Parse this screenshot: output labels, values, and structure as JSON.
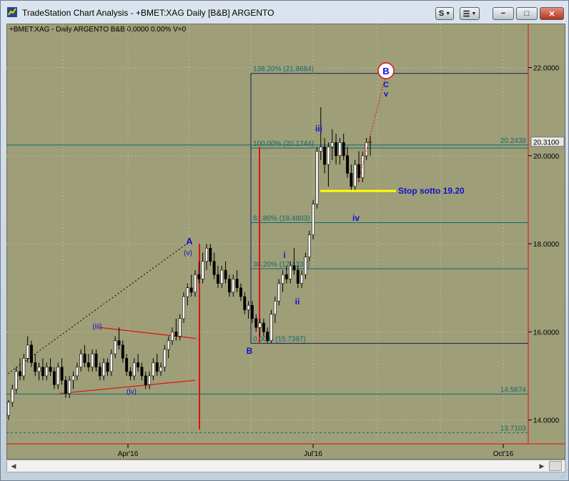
{
  "window": {
    "title": "TradeStation Chart Analysis - +BMET:XAG Daily [B&B] ARGENTO",
    "btn_s": "S",
    "btn_list": "☰",
    "btn_min": "−",
    "btn_max": "□",
    "btn_close": "✕"
  },
  "header": {
    "symbol_info": "+BMET:XAG - Daily  ARGENTO  B&B  0.0000  0.00%  V=0"
  },
  "colors": {
    "background": "#9e9e78",
    "grid": "#b8b894",
    "up_candle": "#ffffff",
    "down_candle": "#000000",
    "fib_line": "#0e6b6b",
    "fib_text": "#0e6b6b",
    "wave_label": "#1010cc",
    "red_line": "#e01010",
    "stop_line": "#ffff00"
  },
  "chart_data": {
    "type": "candlestick",
    "ylim": [
      13.1,
      23.0
    ],
    "yticks": [
      "22.0000",
      "20.0000",
      "18.0000",
      "16.0000",
      "14.0000"
    ],
    "xticks": [
      "Apr'16",
      "Jul'16",
      "Oct'16"
    ],
    "last_price": "20.3100",
    "candles": [
      [
        14.1,
        14.45,
        14.0,
        14.4
      ],
      [
        14.4,
        14.8,
        14.3,
        14.7
      ],
      [
        14.7,
        15.2,
        14.6,
        15.1
      ],
      [
        15.1,
        15.4,
        14.9,
        15.0
      ],
      [
        15.0,
        15.5,
        14.9,
        15.4
      ],
      [
        15.4,
        15.9,
        15.3,
        15.7
      ],
      [
        15.7,
        15.8,
        15.2,
        15.3
      ],
      [
        15.3,
        15.5,
        15.0,
        15.1
      ],
      [
        15.1,
        15.3,
        14.9,
        15.2
      ],
      [
        15.2,
        15.4,
        14.9,
        15.0
      ],
      [
        15.0,
        15.3,
        14.9,
        15.2
      ],
      [
        15.2,
        15.4,
        15.0,
        15.1
      ],
      [
        15.1,
        15.2,
        14.7,
        14.8
      ],
      [
        14.8,
        15.3,
        14.7,
        15.2
      ],
      [
        15.2,
        15.4,
        14.8,
        14.9
      ],
      [
        14.9,
        15.0,
        14.5,
        14.6
      ],
      [
        14.6,
        15.0,
        14.5,
        14.9
      ],
      [
        14.9,
        15.1,
        14.7,
        15.0
      ],
      [
        15.0,
        15.3,
        14.9,
        15.2
      ],
      [
        15.2,
        15.6,
        15.1,
        15.5
      ],
      [
        15.5,
        15.7,
        15.2,
        15.3
      ],
      [
        15.3,
        15.5,
        15.1,
        15.2
      ],
      [
        15.2,
        15.6,
        15.1,
        15.5
      ],
      [
        15.5,
        15.6,
        15.1,
        15.2
      ],
      [
        15.2,
        15.3,
        14.9,
        15.0
      ],
      [
        15.0,
        15.4,
        14.9,
        15.3
      ],
      [
        15.3,
        15.4,
        15.0,
        15.1
      ],
      [
        15.1,
        15.6,
        15.0,
        15.5
      ],
      [
        15.5,
        15.9,
        15.4,
        15.8
      ],
      [
        15.8,
        16.1,
        15.6,
        15.7
      ],
      [
        15.7,
        15.8,
        15.3,
        15.4
      ],
      [
        15.4,
        15.5,
        15.0,
        15.1
      ],
      [
        15.1,
        15.2,
        14.9,
        15.0
      ],
      [
        15.0,
        15.4,
        14.9,
        15.3
      ],
      [
        15.3,
        15.5,
        15.1,
        15.2
      ],
      [
        15.2,
        15.3,
        14.9,
        15.0
      ],
      [
        15.0,
        15.1,
        14.7,
        14.8
      ],
      [
        14.8,
        15.1,
        14.7,
        15.0
      ],
      [
        15.0,
        15.4,
        14.9,
        15.3
      ],
      [
        15.3,
        15.5,
        15.0,
        15.1
      ],
      [
        15.1,
        15.3,
        15.0,
        15.2
      ],
      [
        15.2,
        15.7,
        15.1,
        15.6
      ],
      [
        15.6,
        15.9,
        15.4,
        15.8
      ],
      [
        15.8,
        16.1,
        15.7,
        16.0
      ],
      [
        16.0,
        16.3,
        15.8,
        15.9
      ],
      [
        15.9,
        16.4,
        15.8,
        16.3
      ],
      [
        16.3,
        16.9,
        16.2,
        16.8
      ],
      [
        16.8,
        17.1,
        16.6,
        17.0
      ],
      [
        17.0,
        17.3,
        16.8,
        16.9
      ],
      [
        16.9,
        17.4,
        16.8,
        17.3
      ],
      [
        17.3,
        17.6,
        17.1,
        17.2
      ],
      [
        17.2,
        17.8,
        17.1,
        17.6
      ],
      [
        17.6,
        18.0,
        17.4,
        17.9
      ],
      [
        17.9,
        18.0,
        17.5,
        17.6
      ],
      [
        17.6,
        17.8,
        17.2,
        17.3
      ],
      [
        17.3,
        17.5,
        17.0,
        17.1
      ],
      [
        17.1,
        17.5,
        17.0,
        17.4
      ],
      [
        17.4,
        17.6,
        17.1,
        17.2
      ],
      [
        17.2,
        17.3,
        16.8,
        16.9
      ],
      [
        16.9,
        17.3,
        16.8,
        17.2
      ],
      [
        17.2,
        17.4,
        16.9,
        17.0
      ],
      [
        17.0,
        17.1,
        16.7,
        16.8
      ],
      [
        16.8,
        16.9,
        16.4,
        16.5
      ],
      [
        16.5,
        16.7,
        16.3,
        16.6
      ],
      [
        16.6,
        16.7,
        16.2,
        16.3
      ],
      [
        16.3,
        16.4,
        16.0,
        16.1
      ],
      [
        16.1,
        16.3,
        15.9,
        16.2
      ],
      [
        16.2,
        16.3,
        15.9,
        16.0
      ],
      [
        16.0,
        16.1,
        15.75,
        15.8
      ],
      [
        15.8,
        16.5,
        15.75,
        16.4
      ],
      [
        16.4,
        16.8,
        16.2,
        16.7
      ],
      [
        16.7,
        17.2,
        16.6,
        17.1
      ],
      [
        17.1,
        17.4,
        16.9,
        17.3
      ],
      [
        17.3,
        17.5,
        17.1,
        17.2
      ],
      [
        17.2,
        17.6,
        17.1,
        17.5
      ],
      [
        17.5,
        17.9,
        17.3,
        17.4
      ],
      [
        17.4,
        17.5,
        17.0,
        17.1
      ],
      [
        17.1,
        17.4,
        17.0,
        17.3
      ],
      [
        17.3,
        17.8,
        17.2,
        17.7
      ],
      [
        17.7,
        18.3,
        17.6,
        18.2
      ],
      [
        18.2,
        19.0,
        18.1,
        18.9
      ],
      [
        18.9,
        20.2,
        18.8,
        20.1
      ],
      [
        20.1,
        21.1,
        19.9,
        20.2
      ],
      [
        20.2,
        20.4,
        19.6,
        19.8
      ],
      [
        19.8,
        20.3,
        19.3,
        20.2
      ],
      [
        20.2,
        20.6,
        19.9,
        20.3
      ],
      [
        20.3,
        20.5,
        19.8,
        20.0
      ],
      [
        20.0,
        20.4,
        19.8,
        20.3
      ],
      [
        20.3,
        20.5,
        19.9,
        20.0
      ],
      [
        20.0,
        20.2,
        19.5,
        19.6
      ],
      [
        19.6,
        19.8,
        19.2,
        19.3
      ],
      [
        19.3,
        19.9,
        19.2,
        19.8
      ],
      [
        19.8,
        20.1,
        19.4,
        19.5
      ],
      [
        19.5,
        20.1,
        19.4,
        20.0
      ],
      [
        20.0,
        20.4,
        19.9,
        20.3
      ],
      [
        20.3,
        20.45,
        20.0,
        20.31
      ]
    ],
    "fibonacci": [
      {
        "label": "138.20% (21.8684)",
        "value": 21.8684
      },
      {
        "label": "100.00% (20.1744)",
        "value": 20.1744
      },
      {
        "label": "61.80% (18.4803)",
        "value": 18.4803
      },
      {
        "label": "38.20% (17.4337)",
        "value": 17.4337
      },
      {
        "label": "0.00% (15.7397)",
        "value": 15.7397
      }
    ],
    "levels": [
      {
        "label": "20.2439",
        "value": 20.2439
      },
      {
        "label": "14.5874",
        "value": 14.5874
      },
      {
        "label": "13.7103",
        "value": 13.7103
      }
    ],
    "stop": {
      "label": "Stop sotto  19.20",
      "value": 19.2
    },
    "wave_labels": {
      "A": "A",
      "v_paren": "(v)",
      "iii_paren": "(iii)",
      "iv_paren": "(iv)",
      "B": "B",
      "i": "i",
      "ii": "ii",
      "iii": "iii",
      "iv": "iv",
      "B_circle": "B",
      "C": "C",
      "v": "v"
    }
  }
}
